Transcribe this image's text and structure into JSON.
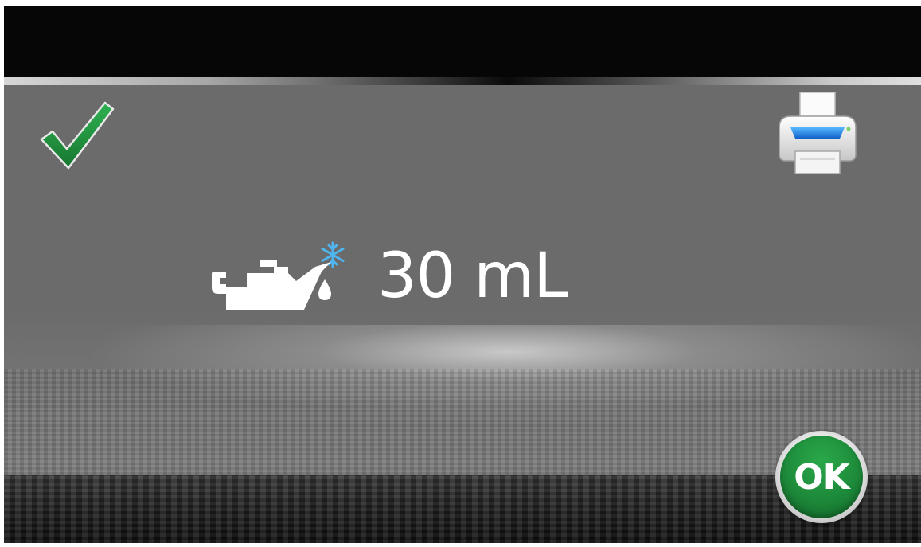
{
  "status": {
    "icon": "checkmark-icon",
    "color": "#1e8f3e"
  },
  "toolbar": {
    "print_icon": "printer-icon"
  },
  "reading": {
    "icon": "oil-can-refrigerant-icon",
    "value": "30",
    "unit": "mL"
  },
  "actions": {
    "ok_label": "OK",
    "ok_color": "#1d8a3a"
  }
}
